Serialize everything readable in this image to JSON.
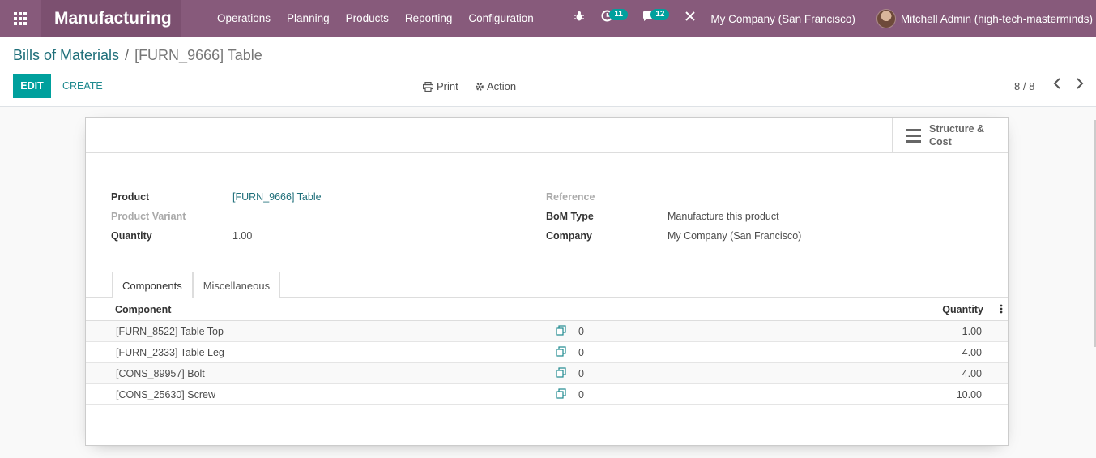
{
  "navbar": {
    "app_name": "Manufacturing",
    "menu": [
      "Operations",
      "Planning",
      "Products",
      "Reporting",
      "Configuration"
    ],
    "activity_count": "11",
    "messages_count": "12",
    "company": "My Company (San Francisco)",
    "user": "Mitchell Admin (high-tech-masterminds)"
  },
  "breadcrumb": {
    "parent": "Bills of Materials",
    "separator": "/",
    "current": "[FURN_9666] Table"
  },
  "toolbar": {
    "edit_label": "EDIT",
    "create_label": "CREATE",
    "print_label": "Print",
    "action_label": "Action",
    "pager": "8 / 8"
  },
  "smart_button": {
    "label_line1": "Structure &",
    "label_line2": "Cost"
  },
  "form": {
    "product_label": "Product",
    "product_value": "[FURN_9666] Table",
    "variant_label": "Product Variant",
    "quantity_label": "Quantity",
    "quantity_value": "1.00",
    "reference_label": "Reference",
    "bom_type_label": "BoM Type",
    "bom_type_value": "Manufacture this product",
    "company_label": "Company",
    "company_value": "My Company (San Francisco)"
  },
  "tabs": [
    "Components",
    "Miscellaneous"
  ],
  "table": {
    "col_component": "Component",
    "col_quantity": "Quantity",
    "rows": [
      {
        "name": "[FURN_8522] Table Top",
        "zero": "0",
        "qty": "1.00"
      },
      {
        "name": "[FURN_2333] Table Leg",
        "zero": "0",
        "qty": "4.00"
      },
      {
        "name": "[CONS_89957] Bolt",
        "zero": "0",
        "qty": "4.00"
      },
      {
        "name": "[CONS_25630] Screw",
        "zero": "0",
        "qty": "10.00"
      }
    ]
  },
  "colors": {
    "navbar": "#875a7b",
    "brand_bg": "#7c5070",
    "primary": "#00a09d",
    "link": "#1f6f7a"
  },
  "icons": [
    "apps-grid-icon",
    "bug-icon",
    "clock-icon",
    "chat-icon",
    "tools-icon",
    "print-icon",
    "gear-icon",
    "chevron-left-icon",
    "chevron-right-icon",
    "hamburger-icon",
    "copy-icon",
    "kebab-icon"
  ]
}
